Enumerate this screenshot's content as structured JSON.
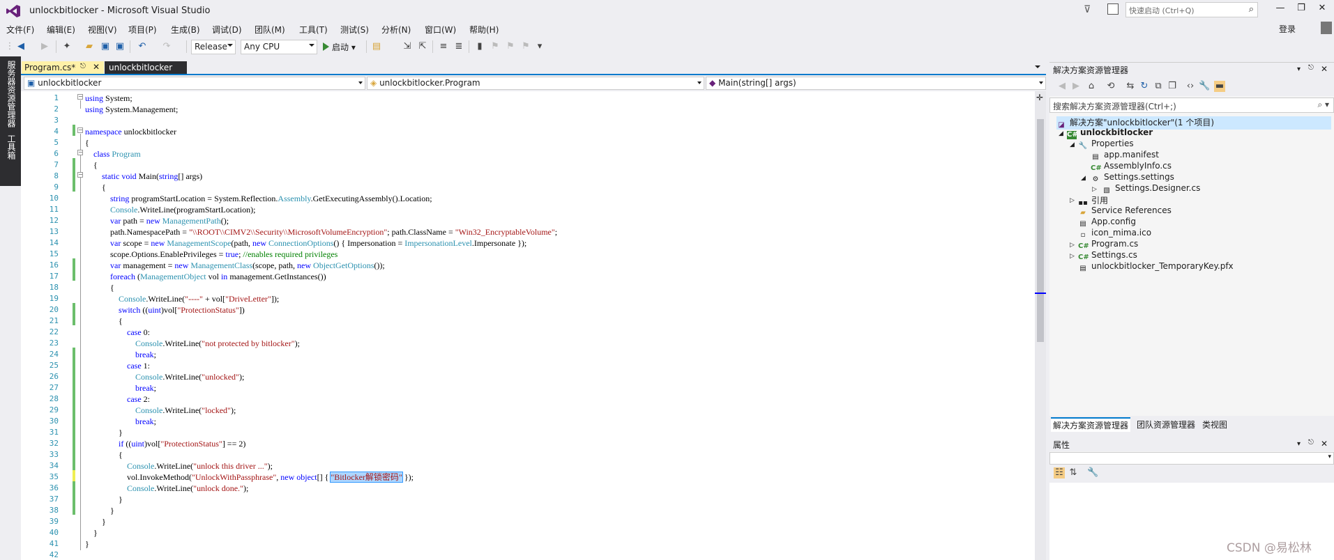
{
  "window": {
    "title": "unlockbitlocker - Microsoft Visual Studio",
    "quick_launch_placeholder": "快速启动 (Ctrl+Q)",
    "login": "登录"
  },
  "menu": [
    "文件(F)",
    "编辑(E)",
    "视图(V)",
    "项目(P)",
    "生成(B)",
    "调试(D)",
    "团队(M)",
    "工具(T)",
    "测试(S)",
    "分析(N)",
    "窗口(W)",
    "帮助(H)"
  ],
  "toolbar": {
    "configuration": "Release",
    "platform": "Any CPU",
    "start_label": "启动"
  },
  "side_tabs": [
    "服务器资源管理器",
    "工具箱"
  ],
  "doc_tabs": [
    {
      "label": "Program.cs*",
      "active": true
    },
    {
      "label": "unlockbitlocker",
      "active": false
    }
  ],
  "navbar": {
    "project": "unlockbitlocker",
    "type": "unlockbitlocker.Program",
    "member": "Main(string[] args)"
  },
  "code_lines": [
    "using System;",
    "using System.Management;",
    "",
    "namespace unlockbitlocker",
    "{",
    "class Program",
    "{",
    "static void Main(string[] args)",
    "{",
    "string programStartLocation = System.Reflection.Assembly.GetExecutingAssembly().Location;",
    "Console.WriteLine(programStartLocation);",
    "var path = new ManagementPath();",
    "path.NamespacePath = \"\\\\ROOT\\\\CIMV2\\\\Security\\\\MicrosoftVolumeEncryption\"; path.ClassName = \"Win32_EncryptableVolume\";",
    "var scope = new ManagementScope(path, new ConnectionOptions() { Impersonation = ImpersonationLevel.Impersonate });",
    "scope.Options.EnablePrivileges = true; //enables required privileges",
    "var management = new ManagementClass(scope, path, new ObjectGetOptions());",
    "foreach (ManagementObject vol in management.GetInstances())",
    "{",
    "Console.WriteLine(\"----\" + vol[\"DriveLetter\"]);",
    "switch ((uint)vol[\"ProtectionStatus\"])",
    "{",
    "case 0:",
    "Console.WriteLine(\"not protected by bitlocker\");",
    "break;",
    "case 1:",
    "Console.WriteLine(\"unlocked\");",
    "break;",
    "case 2:",
    "Console.WriteLine(\"locked\");",
    "break;",
    "}",
    "if ((uint)vol[\"ProtectionStatus\"] == 2)",
    "{",
    "Console.WriteLine(\"unlock this driver ...\");",
    "vol.InvokeMethod(\"UnlockWithPassphrase\", new object[] { \"Bitlocker解锁密码\" });",
    "Console.WriteLine(\"unlock done.\");",
    "}",
    "}",
    "}",
    "}",
    "}",
    ""
  ],
  "solution_explorer": {
    "title": "解决方案资源管理器",
    "search_placeholder": "搜索解决方案资源管理器(Ctrl+;)",
    "solution": "解决方案\"unlockbitlocker\"(1 个项目)",
    "project": "unlockbitlocker",
    "items": [
      "Properties",
      "app.manifest",
      "AssemblyInfo.cs",
      "Settings.settings",
      "Settings.Designer.cs",
      "引用",
      "Service References",
      "App.config",
      "icon_mima.ico",
      "Program.cs",
      "Settings.cs",
      "unlockbitlocker_TemporaryKey.pfx"
    ],
    "tabs": [
      "解决方案资源管理器",
      "团队资源管理器",
      "类视图"
    ]
  },
  "properties": {
    "title": "属性"
  },
  "watermark": "CSDN @易松林",
  "colors": {
    "accent": "#007acc",
    "keyword": "#0000ff",
    "type": "#2b91af",
    "string": "#a31515",
    "comment": "#008000"
  }
}
